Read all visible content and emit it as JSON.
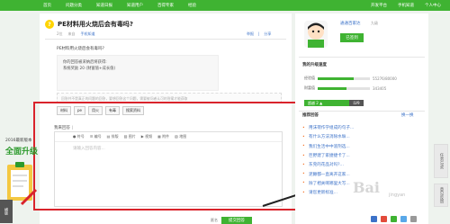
{
  "nav": {
    "items": [
      "首页",
      "问题分类",
      "知道日报",
      "知道用户",
      "百得专家",
      "经验"
    ],
    "right": [
      "开发平台",
      "手机知道",
      "个人中心"
    ]
  },
  "question": {
    "badge": "?",
    "title": "PE材料用火烧后会有毒吗?",
    "meta": [
      "2位",
      "手机知道",
      "来自"
    ],
    "actions": [
      "举报",
      "|",
      "分享"
    ],
    "body": "PE材料用火烧后会有毒吗?",
    "quote_lines": [
      "你的回答被采纳后将获得:",
      "系统奖励 20 (财富值+成长值)"
    ],
    "quote_highlight": "20",
    "hint": "回答并不是真正的问题的回答，要想回答这个问题，需要被问者认可的答案才能获取"
  },
  "tags": [
    "材料",
    "pe",
    "用火",
    "有毒",
    "搜索资料"
  ],
  "editor": {
    "label": "我来回答",
    "tip": "|",
    "toolbar": [
      "● 符号",
      "☰ 编号",
      "▤ 排版",
      "▨ 图片",
      "▶ 视频",
      "▦ 附件",
      "▧ 地图"
    ],
    "placeholder": "请输入回答内容..."
  },
  "submit": {
    "anon": "匿名",
    "label": "提交回答"
  },
  "promo": {
    "sub": "2016最新版本",
    "main": "全面升级",
    "btn": "横版"
  },
  "profile": {
    "username": "通通百家达",
    "level": "九级",
    "sign_label": "已签到"
  },
  "growth": {
    "title": "我的升级速度",
    "rows": [
      {
        "label": "经验值",
        "value": "55276/80000",
        "fraction": 0.69
      },
      {
        "label": "财富值",
        "value": "343405",
        "fraction": 0.55
      }
    ],
    "level_label": "超越 2 ▲",
    "level_current": "LV9"
  },
  "recommend": {
    "title": "推荐回答",
    "change": "换一换",
    "items": [
      "用沫荷作学组成的句子...",
      "有什么方法消除水垢...",
      "我们生活中中溶剂选...",
      "巨野建了家捷捷卡了...",
      "东莞的花品对吗?...",
      "泥鳅都一直离开这家...",
      "除了相关啊哪里大写...",
      "请您更新标准..."
    ]
  },
  "side_tabs": [
    "任务与奖",
    "意见反馈"
  ],
  "watermark": {
    "main": "Bai",
    "sub": "jingyan"
  }
}
